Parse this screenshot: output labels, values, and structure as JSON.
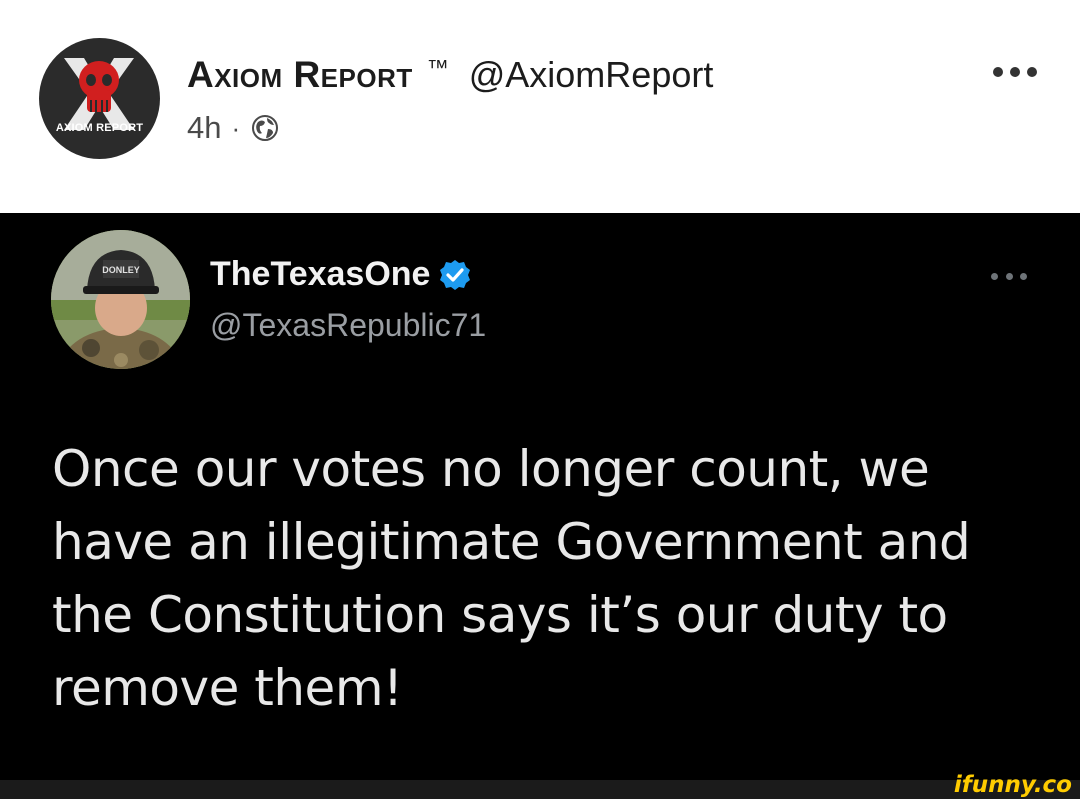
{
  "post": {
    "author_name": "Axiom Report",
    "trademark": "™",
    "author_handle": "@AxiomReport",
    "avatar_label": "AXIOM REPORT",
    "time_ago": "4h",
    "separator": "·",
    "visibility_icon": "globe-icon",
    "more_icon": "more-dots-icon"
  },
  "tweet": {
    "display_name": "TheTexasOne",
    "verified_icon": "verified-badge-icon",
    "verified_color": "#1d9bf0",
    "handle": "@TexasRepublic71",
    "hat_text": "DONLEY",
    "text": "Once our votes no longer count, we have an illegitimate Government and the Constitution says it’s our duty to remove them!",
    "more_icon": "more-dots-icon"
  },
  "watermark": {
    "text": "ifunny.co",
    "color": "#ffcc00"
  }
}
